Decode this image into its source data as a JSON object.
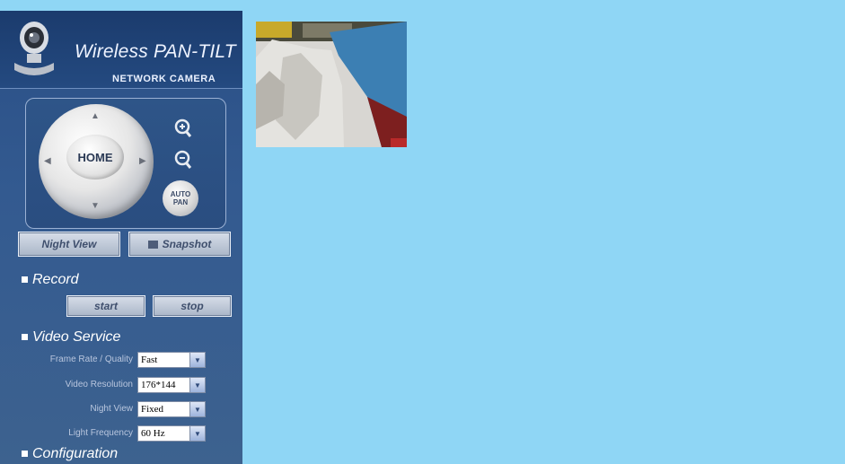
{
  "header": {
    "title": "Wireless PAN-TILT",
    "subtitle": "NETWORK CAMERA"
  },
  "ptz": {
    "home_label": "HOME",
    "auto_label_line1": "AUTO",
    "auto_label_line2": "PAN"
  },
  "buttons": {
    "night_view": "Night View",
    "snapshot": "Snapshot"
  },
  "record": {
    "heading": "Record",
    "start": "start",
    "stop": "stop"
  },
  "video_service": {
    "heading": "Video Service",
    "fields": [
      {
        "label": "Frame Rate / Quality",
        "value": "Fast"
      },
      {
        "label": "Video Resolution",
        "value": "176*144"
      },
      {
        "label": "Night View",
        "value": "Fixed"
      },
      {
        "label": "Light Frequency",
        "value": "60 Hz"
      }
    ]
  },
  "configuration": {
    "heading": "Configuration"
  },
  "colors": {
    "page_background": "#8fd6f5",
    "sidebar": "#2f5589"
  }
}
